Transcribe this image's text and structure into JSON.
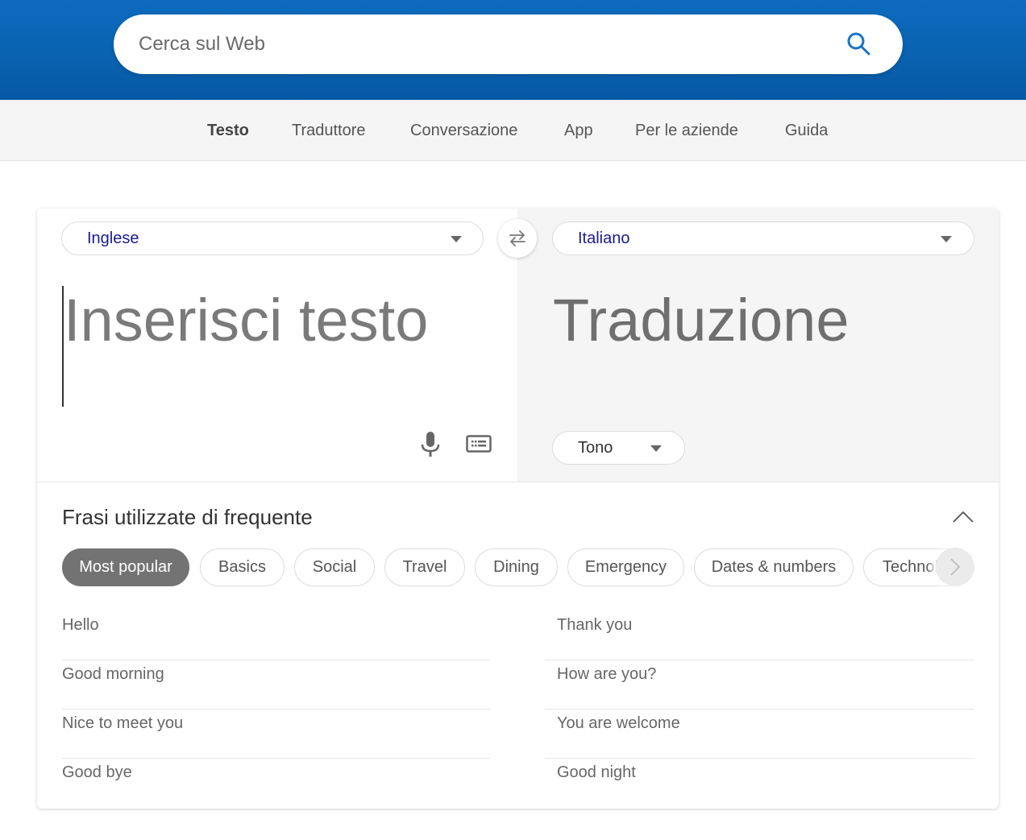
{
  "header": {
    "search_placeholder": "Cerca sul Web",
    "search_icon": "search-icon",
    "colors": {
      "brand_blue": "#0a63b2",
      "icon_blue": "#1a73c8"
    }
  },
  "nav": {
    "items": [
      {
        "label": "Testo",
        "active": true
      },
      {
        "label": "Traduttore",
        "active": false
      },
      {
        "label": "Conversazione",
        "active": false
      },
      {
        "label": "App",
        "active": false
      },
      {
        "label": "Per le aziende",
        "active": false
      },
      {
        "label": "Guida",
        "active": false
      }
    ]
  },
  "translator": {
    "source_language": "Inglese",
    "target_language": "Italiano",
    "swap_icon": "swap-arrows-icon",
    "source_placeholder": "Inserisci testo",
    "source_value": "",
    "translation_placeholder": "Traduzione",
    "mic_icon": "microphone-icon",
    "keyboard_icon": "keyboard-icon",
    "tone_label": "Tono",
    "colors": {
      "language_text": "#1a1a8c"
    }
  },
  "phrases": {
    "title": "Frasi utilizzate di frequente",
    "collapse_icon": "chevron-up-icon",
    "categories": [
      {
        "label": "Most popular",
        "active": true
      },
      {
        "label": "Basics",
        "active": false
      },
      {
        "label": "Social",
        "active": false
      },
      {
        "label": "Travel",
        "active": false
      },
      {
        "label": "Dining",
        "active": false
      },
      {
        "label": "Emergency",
        "active": false
      },
      {
        "label": "Dates & numbers",
        "active": false
      },
      {
        "label": "Technol",
        "active": false
      }
    ],
    "scroll_icon": "chevron-right-icon",
    "left_column": [
      "Hello",
      "Good morning",
      "Nice to meet you",
      "Good bye"
    ],
    "right_column": [
      "Thank you",
      "How are you?",
      "You are welcome",
      "Good night"
    ]
  }
}
